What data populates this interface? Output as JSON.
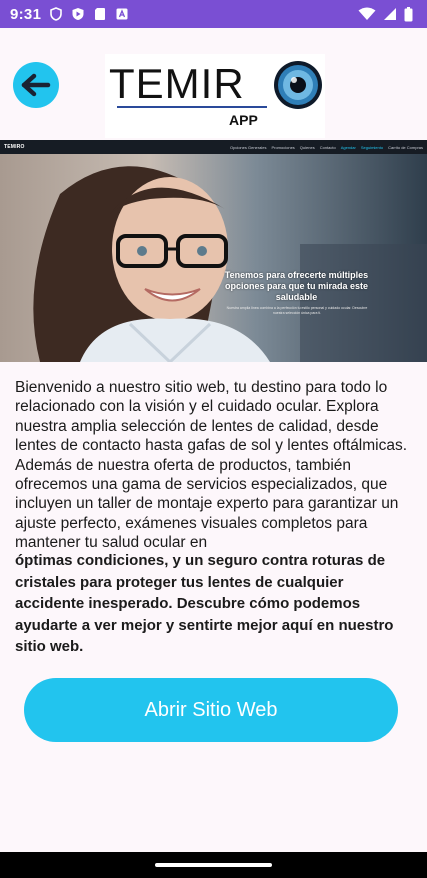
{
  "status_bar": {
    "time": "9:31",
    "left_icons": [
      "shield-icon",
      "play-protect-icon",
      "sd-card-icon",
      "app-notification-icon"
    ],
    "right_icons": [
      "wifi-icon",
      "signal-icon",
      "battery-icon"
    ],
    "color": "#7a4fd3"
  },
  "header": {
    "back_icon": "arrow-left-icon",
    "accent": "#22c4ee",
    "logo": {
      "word": "TEMIR",
      "subtitle": "APP"
    }
  },
  "hero": {
    "brand": "TEMIRO",
    "menu": [
      "Opciones Generales",
      "Promociones",
      "Quienes",
      "Contacto",
      "Agendar",
      "Seguimiento",
      "Carrito de Compras"
    ],
    "caption": "Tenemos para ofrecerte múltiples opciones para que tu mirada este saludable",
    "small_text": "Nuestra amplia línea combina a la perfección tu estilo personal y cuidado ocular. Descubre nuestra selección única para ti."
  },
  "content": {
    "intro": "Bienvenido a nuestro sitio web, tu destino para todo lo relacionado con la visión y el cuidado ocular. Explora nuestra amplia selección de lentes de calidad, desde lentes de contacto hasta gafas de sol y lentes oftálmicas. Además de nuestra oferta de productos, también ofrecemos una gama de servicios especializados, que incluyen un taller de montaje experto para garantizar un ajuste perfecto, exámenes visuales completos para mantener tu salud ocular en",
    "intro_bold": "óptimas condiciones, y un seguro contra roturas de cristales para proteger tus lentes de cualquier accidente inesperado. Descubre cómo podemos ayudarte a ver mejor y sentirte mejor aquí en nuestro sitio web."
  },
  "actions": {
    "open_site_label": "Abrir Sitio Web"
  }
}
